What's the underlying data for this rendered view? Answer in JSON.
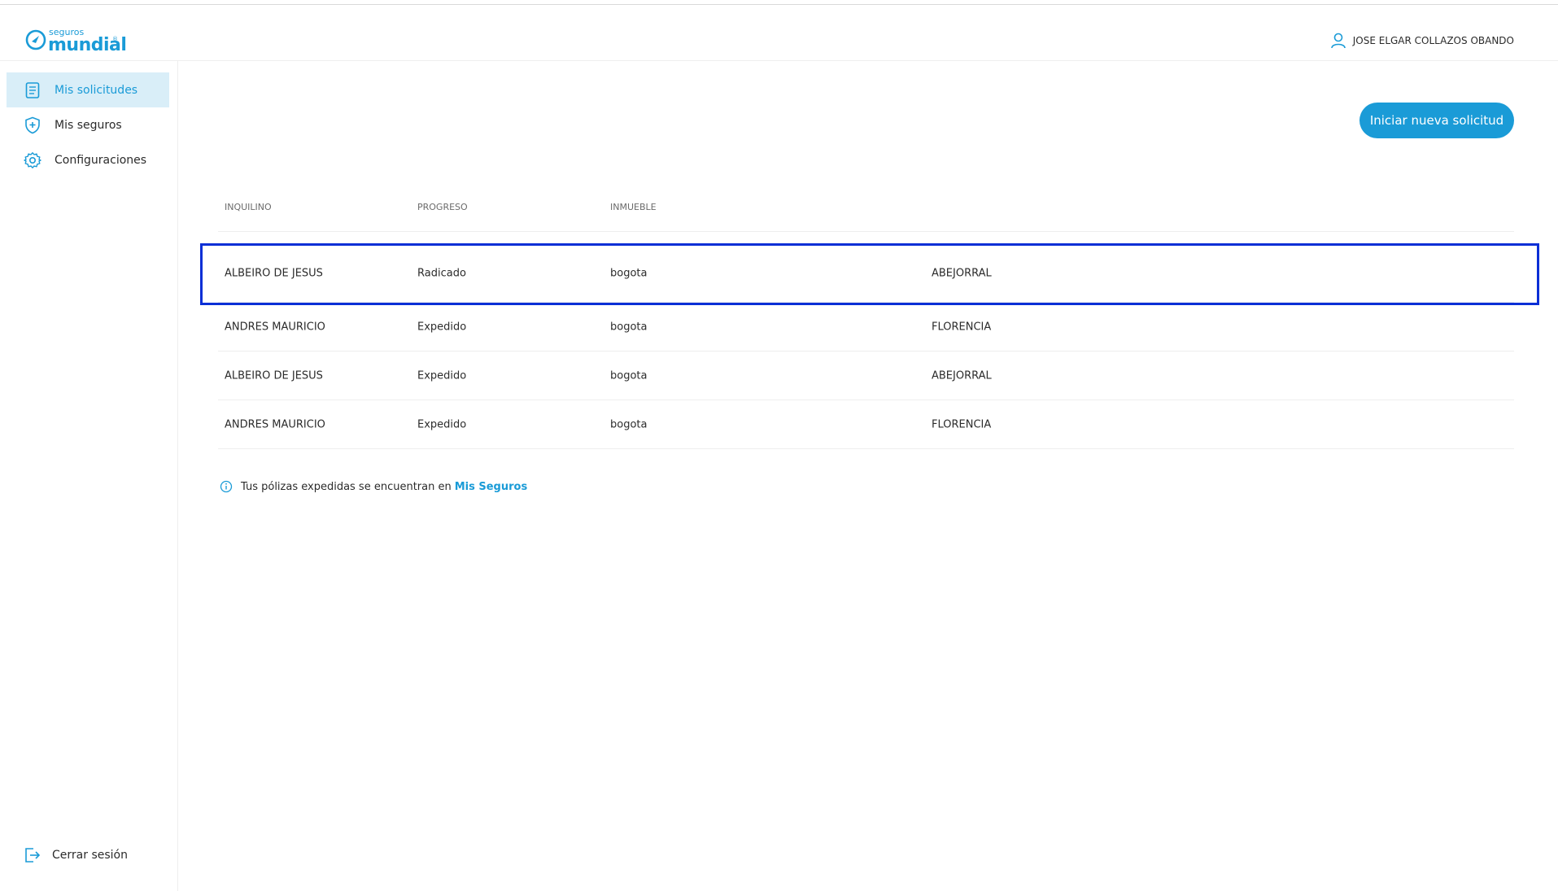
{
  "brand": {
    "small": "seguros",
    "big": "mundial",
    "reg": "®",
    "color": "#1a9bd7"
  },
  "user": {
    "name": "JOSE ELGAR COLLAZOS OBANDO"
  },
  "sidebar": {
    "items": [
      {
        "label": "Mis solicitudes",
        "icon": "document-icon",
        "active": true
      },
      {
        "label": "Mis seguros",
        "icon": "shield-plus-icon",
        "active": false
      },
      {
        "label": "Configuraciones",
        "icon": "gear-icon",
        "active": false
      }
    ],
    "logout": {
      "label": "Cerrar sesión",
      "icon": "logout-icon"
    }
  },
  "actions": {
    "new_request": "Iniciar nueva solicitud"
  },
  "table": {
    "headers": [
      "INQUILINO",
      "PROGRESO",
      "INMUEBLE",
      ""
    ],
    "rows": [
      [
        "ALBEIRO DE JESUS",
        "Radicado",
        "bogota",
        "ABEJORRAL"
      ],
      [
        "ANDRES MAURICIO",
        "Expedido",
        "bogota",
        "FLORENCIA"
      ],
      [
        "ALBEIRO DE JESUS",
        "Expedido",
        "bogota",
        "ABEJORRAL"
      ],
      [
        "ANDRES MAURICIO",
        "Expedido",
        "bogota",
        "FLORENCIA"
      ]
    ]
  },
  "info": {
    "text": "Tus pólizas expedidas se encuentran en",
    "link": "Mis Seguros",
    "icon": "info-icon"
  },
  "colors": {
    "accent": "#1a9bd7",
    "highlight": "#0a2fd6",
    "active_bg": "#d9eef8"
  }
}
